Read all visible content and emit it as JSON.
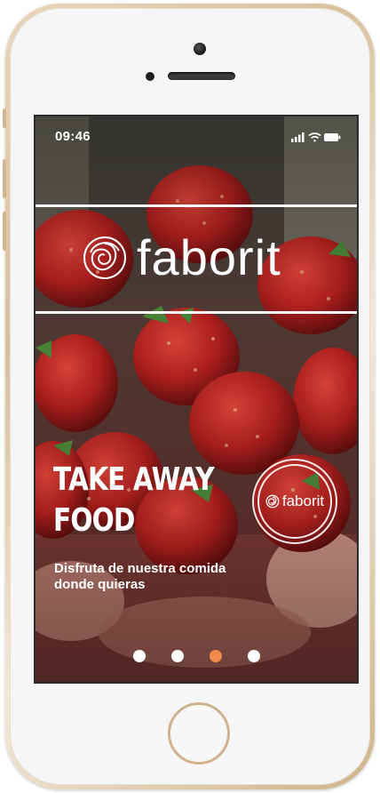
{
  "status_bar": {
    "time": "09:46"
  },
  "brand": {
    "name": "faborit"
  },
  "promo": {
    "headline_line1": "TAKE AWAY",
    "headline_line2": "FOOD",
    "subtitle": "Disfruta de nuestra comida donde quieras"
  },
  "badge": {
    "name": "faborit"
  },
  "pager": {
    "total": 4,
    "active_index": 2
  },
  "icons": [
    "signal-icon",
    "wifi-icon",
    "battery-icon",
    "faborit-logo-icon"
  ],
  "colors": {
    "accent_dot": "#ef8a4c",
    "text": "#ffffff"
  }
}
